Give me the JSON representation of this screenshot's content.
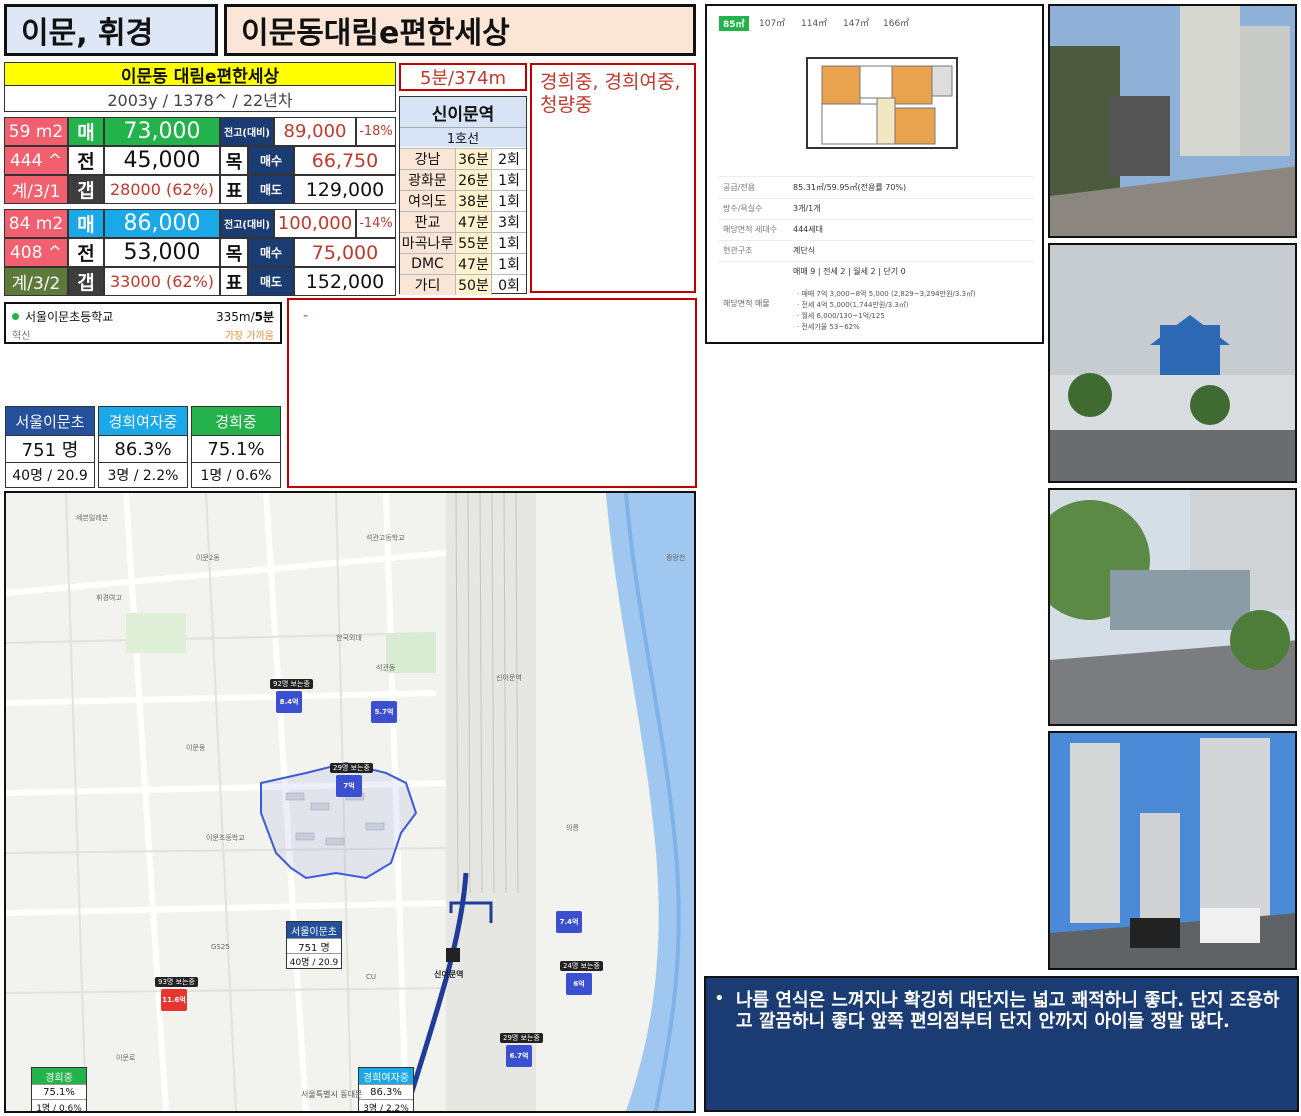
{
  "header": {
    "region": "이문, 휘경",
    "complex_name": "이문동대림e편한세상"
  },
  "summary": {
    "title": "이문동 대림e편한세상",
    "info": "2003y / 1378^ / 22년차"
  },
  "commute_time": "5분/374m",
  "schools_note": "경희중, 경희여중, 청량중",
  "station": {
    "name": "신이문역",
    "line": "1호선",
    "rows": [
      {
        "dest": "강남",
        "time": "36분",
        "transfer": "2회"
      },
      {
        "dest": "광화문",
        "time": "26분",
        "transfer": "1회"
      },
      {
        "dest": "여의도",
        "time": "38분",
        "transfer": "1회"
      },
      {
        "dest": "판교",
        "time": "47분",
        "transfer": "3회"
      },
      {
        "dest": "마곡나루",
        "time": "55분",
        "transfer": "1회"
      },
      {
        "dest": "DMC",
        "time": "47분",
        "transfer": "1회"
      },
      {
        "dest": "가디",
        "time": "50분",
        "transfer": "0회"
      }
    ]
  },
  "units": [
    {
      "size": "59 m2",
      "households": "444 ^",
      "structure": "계/3/1",
      "sale_label": "매",
      "sale_price": "73,000",
      "jeonse_label": "전",
      "jeonse_price": "45,000",
      "gap_label": "갭",
      "gap_value": "28000 (62%)",
      "peak_label": "전고(대비)",
      "peak_price": "89,000",
      "peak_diff": "-18%",
      "target_label_1": "목",
      "target_label_2": "표",
      "buy_label": "매수",
      "buy_price": "66,750",
      "sell_label": "매도",
      "sell_price": "129,000"
    },
    {
      "size": "84 m2",
      "households": "408 ^",
      "structure": "계/3/2",
      "sale_label": "매",
      "sale_price": "86,000",
      "jeonse_label": "전",
      "jeonse_price": "53,000",
      "gap_label": "갭",
      "gap_value": "33000 (62%)",
      "peak_label": "전고(대비)",
      "peak_price": "100,000",
      "peak_diff": "-14%",
      "target_label_1": "목",
      "target_label_2": "표",
      "buy_label": "매수",
      "buy_price": "75,000",
      "sell_label": "매도",
      "sell_price": "152,000"
    }
  ],
  "school_info": {
    "name": "서울이문초등학교",
    "distance": "335m/",
    "walk": "5분",
    "tag": "혁신",
    "note": "가장 가까움"
  },
  "memo": "-",
  "school_stats": [
    {
      "name": "서울이문초",
      "value": "751 명",
      "detail": "40명 / 20.9",
      "color": "#25509c"
    },
    {
      "name": "경희여자중",
      "value": "86.3%",
      "detail": "3명 / 2.2%",
      "color": "#1aa9e8"
    },
    {
      "name": "경희중",
      "value": "75.1%",
      "detail": "1명 / 0.6%",
      "color": "#23b24b"
    }
  ],
  "floorplan": {
    "tabs": [
      "85㎡",
      "107㎡",
      "114㎡",
      "147㎡",
      "166㎡"
    ],
    "rows": [
      {
        "label": "공급/전용",
        "value": "85.31㎡/59.95㎡(전용률 70%)"
      },
      {
        "label": "방수/욕실수",
        "value": "3개/1개"
      },
      {
        "label": "해당면적 세대수",
        "value": "444세대"
      },
      {
        "label": "현관구조",
        "value": "계단식"
      }
    ],
    "listing_label": "해당면적 매물",
    "listing_counts": "매매 9 | 전세 2 | 월세 2 | 단기 0",
    "listing_details": [
      "· 매매 7억 3,000~8억 5,000 (2,829~3,294만원/3.3㎡)",
      "· 전세 4억 5,000(1,744만원/3.3㎡)",
      "· 월세 6,000/130~1억/125",
      "· 전세가율 53~62%"
    ]
  },
  "map": {
    "station_label": "신이문역",
    "markers": [
      {
        "top": "92명 보는중",
        "body": "8.4억"
      },
      {
        "top": "",
        "body": "5.7억"
      },
      {
        "top": "29명 보는중",
        "body": "7억"
      },
      {
        "top": "",
        "body": "7.4억"
      },
      {
        "top": "24명 보는중",
        "body": "6억"
      },
      {
        "top": "29명 보는중",
        "body": "6.7억"
      },
      {
        "top": "93명 보는중",
        "body": "11.6억"
      }
    ],
    "place_labels": [
      "세븐일레븐",
      "이문2동",
      "휘경여고",
      "이문초등학교",
      "석관고등학교",
      "한국외대",
      "석관동",
      "이문동",
      "신이문역",
      "중랑천",
      "의릉",
      "이문로",
      "GS25",
      "CU"
    ],
    "school_cards": [
      {
        "name": "서울이문초",
        "value": "751 명",
        "detail": "40명 / 20.9",
        "color": "#25509c"
      },
      {
        "name": "경희중",
        "value": "75.1%",
        "detail": "1명 / 0.6%",
        "color": "#23b24b"
      },
      {
        "name": "경희여자중",
        "value": "86.3%",
        "detail": "3명 / 2.2%",
        "color": "#1aa9e8"
      }
    ],
    "copyright": "서울특별시 동대문"
  },
  "review": "나름 연식은 느껴지나 확깅히 대단지는 넓고 쾌적하니 좋다. 단지 조용하고 깔끔하니 좋다 앞쪽 편의점부터 단지 안까지 아이들 정말 많다.",
  "colors": {
    "yellow": "#ffff00",
    "green": "#23b24b",
    "blue": "#1aa9e8",
    "pink": "#f25f6f",
    "olive": "#5e7a3a",
    "red": "#c00000",
    "navy": "#1b3b73",
    "header_left": "#dde7f5",
    "header_right": "#fbe5d6"
  }
}
